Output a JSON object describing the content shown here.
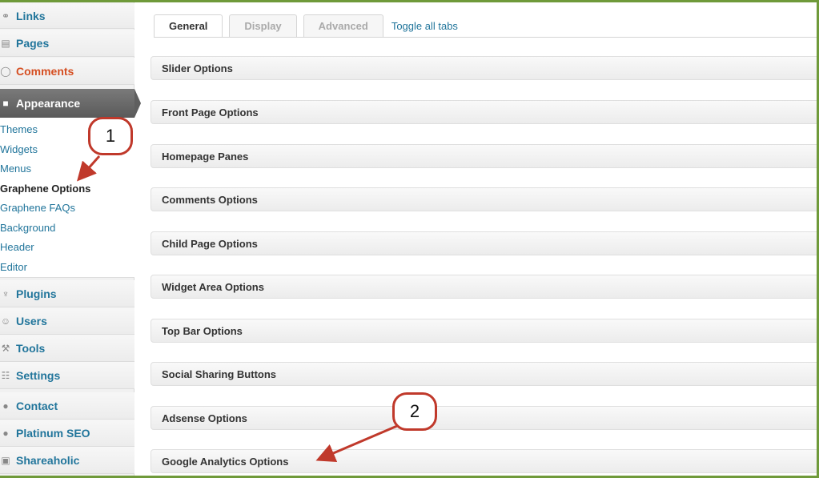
{
  "sidebar": {
    "items_top": [
      {
        "label": "Links",
        "icon": "link-icon"
      },
      {
        "label": "Pages",
        "icon": "pages-icon"
      },
      {
        "label": "Comments",
        "icon": "comment-icon"
      }
    ],
    "appearance": {
      "label": "Appearance",
      "icon": "appearance-icon"
    },
    "submenu": [
      {
        "label": "Themes"
      },
      {
        "label": "Widgets"
      },
      {
        "label": "Menus"
      },
      {
        "label": "Graphene Options",
        "current": true
      },
      {
        "label": "Graphene FAQs"
      },
      {
        "label": "Background"
      },
      {
        "label": "Header"
      },
      {
        "label": "Editor"
      }
    ],
    "items_bottom": [
      {
        "label": "Plugins",
        "icon": "plug-icon"
      },
      {
        "label": "Users",
        "icon": "user-icon"
      },
      {
        "label": "Tools",
        "icon": "tools-icon"
      },
      {
        "label": "Settings",
        "icon": "settings-icon"
      },
      {
        "label": "Contact",
        "icon": "contact-icon"
      },
      {
        "label": "Platinum SEO",
        "icon": "seo-icon"
      },
      {
        "label": "Shareaholic",
        "icon": "share-icon"
      }
    ]
  },
  "tabs": [
    {
      "label": "General",
      "active": true
    },
    {
      "label": "Display",
      "active": false
    },
    {
      "label": "Advanced",
      "active": false
    }
  ],
  "toggle_all": "Toggle all tabs",
  "panels": [
    "Slider Options",
    "Front Page Options",
    "Homepage Panes",
    "Comments Options",
    "Child Page Options",
    "Widget Area Options",
    "Top Bar Options",
    "Social Sharing Buttons",
    "Adsense Options",
    "Google Analytics Options"
  ],
  "annotations": [
    {
      "label": "1"
    },
    {
      "label": "2"
    }
  ],
  "colors": {
    "link": "#21759b",
    "comments": "#d54e21",
    "annotation": "#c0392b",
    "frame": "#6f9a3a"
  }
}
